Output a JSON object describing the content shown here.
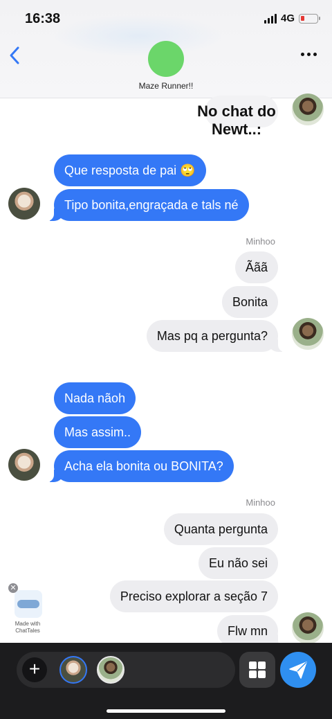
{
  "status_bar": {
    "time": "16:38",
    "network": "4G",
    "battery_color": "#e53935"
  },
  "header": {
    "title": "Maze Runner!!",
    "avatar_color": "#6bd66a"
  },
  "overlay_caption": "No chat do Newt..:",
  "messages": [
    {
      "text": "Que resposta de pai 🙄",
      "side": "in"
    },
    {
      "text": "Tipo bonita,engraçada e tals né",
      "side": "in"
    },
    {
      "text": "Ããã",
      "side": "out"
    },
    {
      "text": "Bonita",
      "side": "out"
    },
    {
      "text": "Mas pq a pergunta?",
      "side": "out"
    },
    {
      "text": "Nada nãoh",
      "side": "in"
    },
    {
      "text": "Mas assim..",
      "side": "in"
    },
    {
      "text": "Acha ela bonita ou BONITA?",
      "side": "in"
    },
    {
      "text": "Quanta pergunta",
      "side": "out"
    },
    {
      "text": "Eu não sei",
      "side": "out"
    },
    {
      "text": "Preciso explorar a seção 7",
      "side": "out"
    },
    {
      "text": "Flw mn",
      "side": "out"
    }
  ],
  "sender_labels": [
    "Minhoo",
    "Minhoo"
  ],
  "watermark": {
    "text": "Made with ChatTales",
    "close": "✕"
  },
  "composer": {
    "plus": "+"
  },
  "colors": {
    "incoming": "#3478f6",
    "outgoing": "#ededf0",
    "send": "#2f8ff0"
  },
  "icons": [
    "back-chevron-icon",
    "more-dots-icon",
    "plus-icon",
    "grid-icon",
    "send-icon"
  ]
}
